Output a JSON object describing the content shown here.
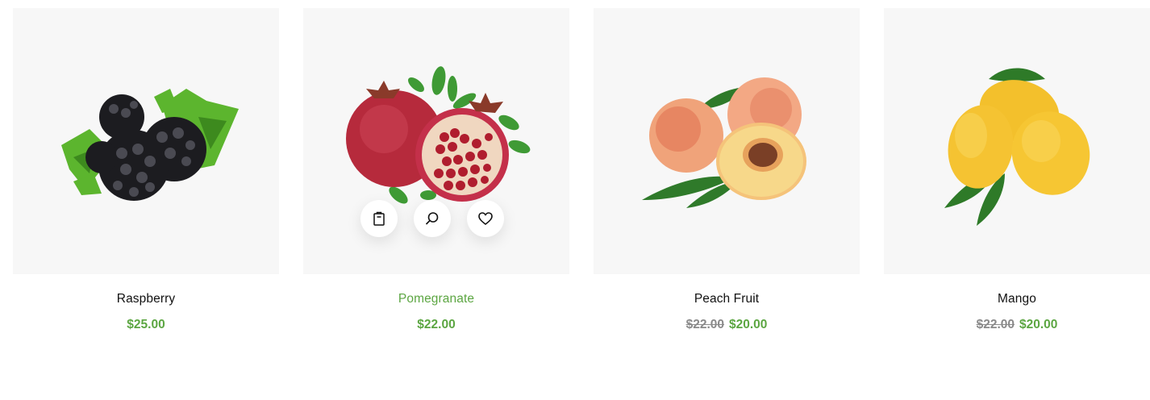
{
  "products": [
    {
      "name": "Raspberry",
      "old_price": "",
      "price": "$25.00",
      "image": "blackberries"
    },
    {
      "name": "Pomegranate",
      "old_price": "",
      "price": "$22.00",
      "image": "pomegranate"
    },
    {
      "name": "Peach Fruit",
      "old_price": "$22.00",
      "price": "$20.00",
      "image": "peaches"
    },
    {
      "name": "Mango",
      "old_price": "$22.00",
      "price": "$20.00",
      "image": "mangoes"
    }
  ],
  "hover_actions": [
    "shopping-bag-icon",
    "search-icon",
    "heart-icon"
  ],
  "colors": {
    "accent": "#5ca642",
    "strike": "#8a8a8a",
    "thumb_bg": "#f7f7f7"
  }
}
